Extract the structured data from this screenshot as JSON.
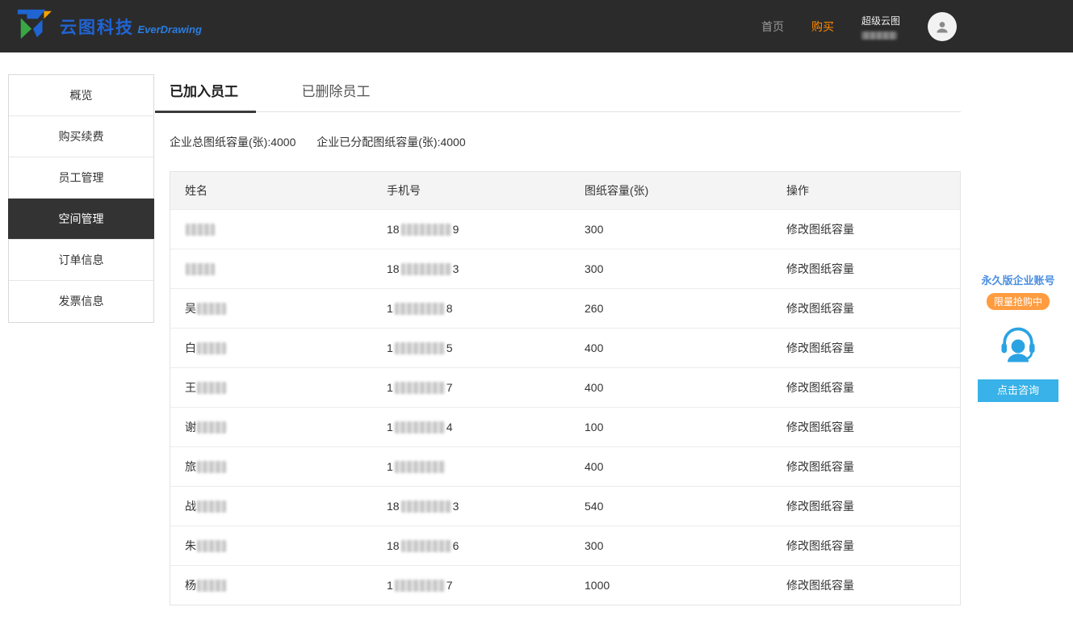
{
  "header": {
    "brand_cn": "云图科技",
    "brand_en": "EverDrawing",
    "nav_home": "首页",
    "nav_buy": "购买",
    "account_type": "超级云图"
  },
  "sidebar": {
    "items": [
      {
        "label": "概览",
        "active": false
      },
      {
        "label": "购买续费",
        "active": false
      },
      {
        "label": "员工管理",
        "active": false
      },
      {
        "label": "空间管理",
        "active": true
      },
      {
        "label": "订单信息",
        "active": false
      },
      {
        "label": "发票信息",
        "active": false
      }
    ]
  },
  "main": {
    "tabs": [
      {
        "label": "已加入员工",
        "active": true
      },
      {
        "label": "已删除员工",
        "active": false
      }
    ],
    "capacity_summary": [
      {
        "label": "企业总图纸容量(张):",
        "value": "4000"
      },
      {
        "label": "企业已分配图纸容量(张):",
        "value": "4000"
      }
    ],
    "table": {
      "headers": [
        "姓名",
        "手机号",
        "图纸容量(张)",
        "操作"
      ],
      "action_label": "修改图纸容量",
      "rows": [
        {
          "name_prefix": "",
          "phone_prefix": "18",
          "phone_suffix": "9",
          "capacity": "300"
        },
        {
          "name_prefix": "",
          "phone_prefix": "18",
          "phone_suffix": "3",
          "capacity": "300"
        },
        {
          "name_prefix": "吴",
          "phone_prefix": "1",
          "phone_suffix": "8",
          "capacity": "260"
        },
        {
          "name_prefix": "白",
          "phone_prefix": "1",
          "phone_suffix": "5",
          "capacity": "400"
        },
        {
          "name_prefix": "王",
          "phone_prefix": "1",
          "phone_suffix": "7",
          "capacity": "400"
        },
        {
          "name_prefix": "谢",
          "phone_prefix": "1",
          "phone_suffix": "4",
          "capacity": "100"
        },
        {
          "name_prefix": "旅",
          "phone_prefix": "1",
          "phone_suffix": "",
          "capacity": "400"
        },
        {
          "name_prefix": "战",
          "phone_prefix": "18",
          "phone_suffix": "3",
          "capacity": "540"
        },
        {
          "name_prefix": "朱",
          "phone_prefix": "18",
          "phone_suffix": "6",
          "capacity": "300"
        },
        {
          "name_prefix": "杨",
          "phone_prefix": "1",
          "phone_suffix": "7",
          "capacity": "1000"
        }
      ]
    }
  },
  "promo": {
    "title": "永久版企业账号",
    "badge": "限量抢购中",
    "button": "点击咨询"
  }
}
